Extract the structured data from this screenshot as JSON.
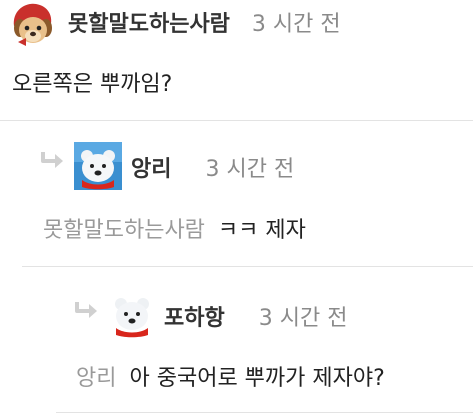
{
  "comments": [
    {
      "author": "못할말도하는사람",
      "time": "3 시간 전",
      "text": "오른쪽은 뿌까임?",
      "avatar_icon": "puppy-red-hood-icon"
    },
    {
      "author": "앙리",
      "time": "3 시간 전",
      "mention": "못할말도하는사람",
      "text": "ㅋㅋ 제자",
      "avatar_icon": "polar-bear-icon"
    },
    {
      "author": "포하항",
      "time": "3 시간 전",
      "mention": "앙리",
      "text": "아 중국어로 뿌까가 제자야?",
      "avatar_icon": "polar-bear-icon"
    }
  ],
  "colors": {
    "author": "#333333",
    "time": "#8a8a8a",
    "mention": "#9a9a9a",
    "divider": "#e3e3e3",
    "reply_arrow": "#d0d0d0",
    "scarf": "#d8261c"
  }
}
